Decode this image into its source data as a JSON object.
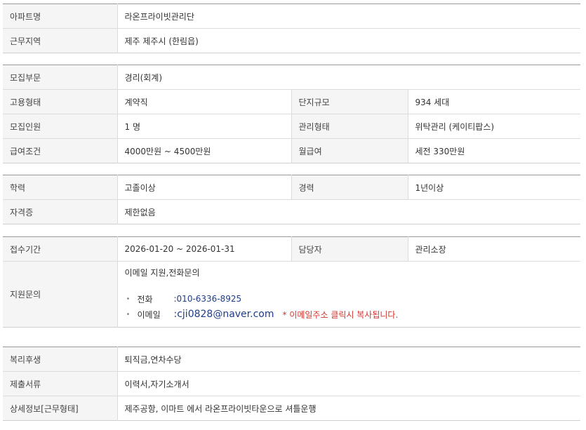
{
  "group1": {
    "apt_name_label": "아파트명",
    "apt_name": "라온프라이빗관리단",
    "region_label": "근무지역",
    "region": "제주 제주시 (한림읍)"
  },
  "group2": {
    "field_label": "모집부문",
    "field": "경리(회계)",
    "emp_type_label": "고용형태",
    "emp_type": "계약직",
    "complex_size_label": "단지규모",
    "complex_size": "934 세대",
    "headcount_label": "모집인원",
    "headcount": "1 명",
    "mgmt_type_label": "관리형태",
    "mgmt_type": "위탁관리 (케이티팝스)",
    "salary_label": "급여조건",
    "salary": "4000만원 ~ 4500만원",
    "monthly_label": "월급여",
    "monthly": "세전 330만원"
  },
  "group3": {
    "edu_label": "학력",
    "edu": "고졸이상",
    "exp_label": "경력",
    "exp": "1년이상",
    "cert_label": "자격증",
    "cert": "제한없음"
  },
  "group4": {
    "period_label": "접수기간",
    "period": "2026-01-20 ~ 2026-01-31",
    "manager_label": "담당자",
    "manager": "관리소장",
    "inquiry_label": "지원문의",
    "inquiry": "이메일 지원,전화문의",
    "bullet": "•",
    "phone_label": "전화",
    "phone": ":010-6336-8925",
    "email_label": "이메일",
    "email": ":cji0828@naver.com",
    "email_note": "* 이메일주소 클릭시 복사됩니다."
  },
  "group5": {
    "welfare_label": "복리후생",
    "welfare": "퇴직금,연차수당",
    "docs_label": "제출서류",
    "docs": "이력서,자기소개서",
    "detail_label": "상세정보[근무형태]",
    "detail": "제주공항, 이마트 에서 라온프라이빗타운으로 셔틀운행"
  }
}
